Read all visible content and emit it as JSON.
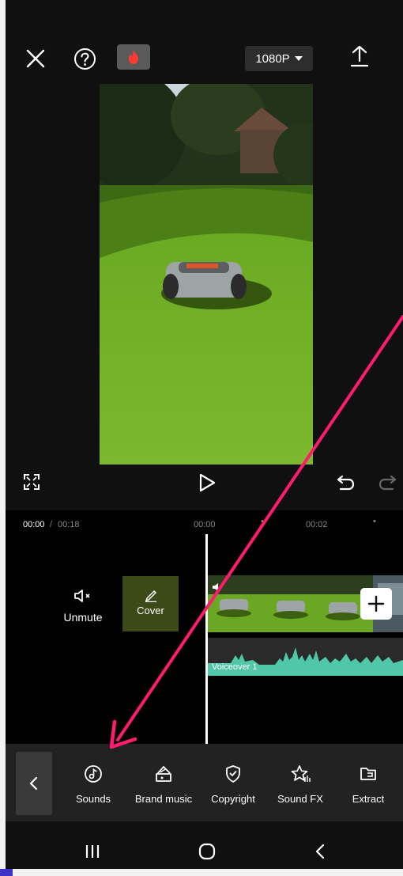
{
  "editor": {
    "resolution": "1080P",
    "time_current": "00:00",
    "time_separator": "/",
    "time_total": "00:18",
    "ruler_marks": [
      "00:00",
      "00:02"
    ]
  },
  "track": {
    "mute_label": "Unmute",
    "cover_label": "Cover",
    "voiceover_label": "Voiceover 1"
  },
  "toolbar": {
    "items": [
      {
        "label": "Sounds",
        "icon": "music-note-icon"
      },
      {
        "label": "Brand music",
        "icon": "brand-music-icon"
      },
      {
        "label": "Copyright",
        "icon": "shield-check-icon"
      },
      {
        "label": "Sound FX",
        "icon": "star-sound-icon"
      },
      {
        "label": "Extract",
        "icon": "folder-icon"
      }
    ]
  },
  "colors": {
    "accent_arrow": "#ff1c6e",
    "waveform": "#4fc7a8",
    "background": "#101010"
  }
}
